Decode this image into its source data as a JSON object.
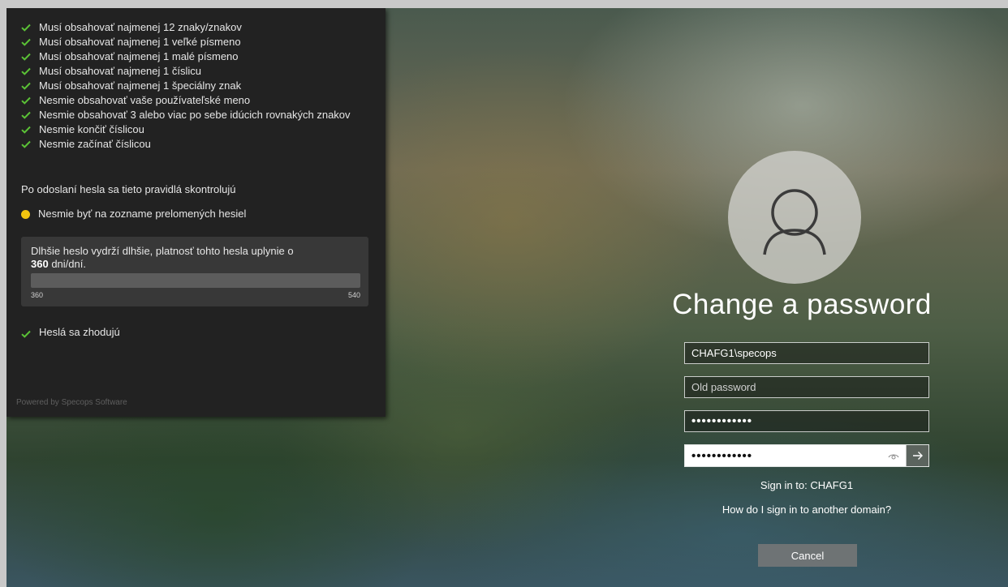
{
  "policy_panel": {
    "rules": [
      {
        "text": "Musí obsahovať najmenej 12 znaky/znakov",
        "status": "met"
      },
      {
        "text": "Musí obsahovať najmenej 1 veľké písmeno",
        "status": "met"
      },
      {
        "text": "Musí obsahovať najmenej 1 malé písmeno",
        "status": "met"
      },
      {
        "text": "Musí obsahovať najmenej 1 číslicu",
        "status": "met"
      },
      {
        "text": "Musí obsahovať najmenej 1 špeciálny znak",
        "status": "met"
      },
      {
        "text": "Nesmie obsahovať vaše používateľské meno",
        "status": "met"
      },
      {
        "text": "Nesmie obsahovať 3 alebo viac po sebe idúcich rovnakých znakov",
        "status": "met"
      },
      {
        "text": "Nesmie končiť číslicou",
        "status": "met"
      },
      {
        "text": "Nesmie začínať číslicou",
        "status": "met"
      }
    ],
    "after_submit_note": "Po odoslaní hesla sa tieto pravidlá skontrolujú",
    "breached_rule": {
      "text": "Nesmie byť na zozname prelomených hesiel",
      "status": "pending"
    },
    "expiry": {
      "text_before": "Dlhšie heslo vydrží dlhšie, platnosť tohto hesla uplynie o",
      "days": "360",
      "text_after": " dni/dní.",
      "slider_min": "360",
      "slider_max": "540",
      "slider_fraction": 0.0
    },
    "match_rule": {
      "text": "Heslá sa zhodujú",
      "status": "met"
    },
    "powered_by": "Powered by Specops Software"
  },
  "login": {
    "title": "Change a password",
    "username_value": "CHAFG1\\specops",
    "old_password_placeholder": "Old password",
    "new_password_value": "••••••••••••",
    "confirm_password_value": "••••••••••••",
    "sign_in_to": "Sign in to: CHAFG1",
    "other_domain_link": "How do I sign in to another domain?",
    "cancel_label": "Cancel"
  },
  "colors": {
    "check": "#5bc236",
    "pending_dot": "#f2c40f",
    "panel_bg": "#222222"
  },
  "icons": {
    "rule_met": "check-icon",
    "rule_pending": "dot-icon",
    "avatar": "user-icon",
    "reveal": "eye-icon",
    "submit": "arrow-right-icon"
  }
}
